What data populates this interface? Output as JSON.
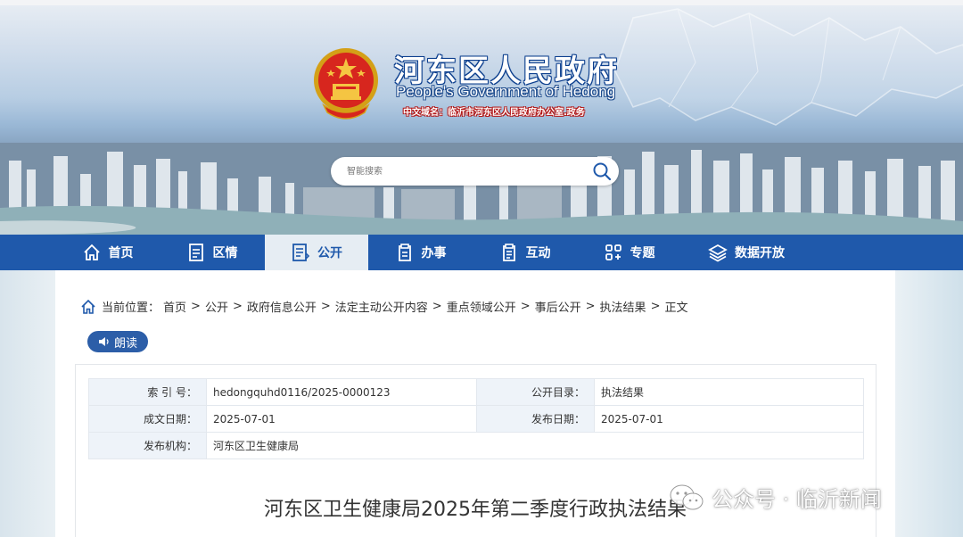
{
  "header": {
    "title_cn": "河东区人民政府",
    "title_en": "People's Government of Hedong",
    "domain_text": "中文域名：临沂市河东区人民政府办公室.政务",
    "search_placeholder": "智能搜索"
  },
  "nav": {
    "items": [
      {
        "label": "首页",
        "icon": "home-icon"
      },
      {
        "label": "区情",
        "icon": "document-icon"
      },
      {
        "label": "公开",
        "icon": "file-list-icon",
        "active": true
      },
      {
        "label": "办事",
        "icon": "clipboard-icon"
      },
      {
        "label": "互动",
        "icon": "chat-clipboard-icon"
      },
      {
        "label": "专题",
        "icon": "grid-link-icon"
      },
      {
        "label": "数据开放",
        "icon": "layers-icon"
      }
    ]
  },
  "breadcrumb": {
    "prefix": "当前位置：",
    "items": [
      "首页",
      "公开",
      "政府信息公开",
      "法定主动公开内容",
      "重点领域公开",
      "事后公开",
      "执法结果",
      "正文"
    ],
    "separator": ">"
  },
  "read_button": {
    "label": "朗读"
  },
  "meta": {
    "index_label": "索 引 号：",
    "index_value": "hedongquhd0116/2025-0000123",
    "catalog_label": "公开目录：",
    "catalog_value": "执法结果",
    "created_label": "成文日期：",
    "created_value": "2025-07-01",
    "published_label": "发布日期：",
    "published_value": "2025-07-01",
    "publisher_label": "发布机构：",
    "publisher_value": "河东区卫生健康局"
  },
  "document": {
    "title": "河东区卫生健康局2025年第二季度行政执法结果"
  },
  "watermark": {
    "text": "公众号 · 临沂新闻"
  },
  "colors": {
    "nav_bg": "#1f59ab",
    "nav_active_bg": "#e6edf3",
    "label_bg": "#eef3f9",
    "read_button_bg": "#2c5ea8"
  }
}
